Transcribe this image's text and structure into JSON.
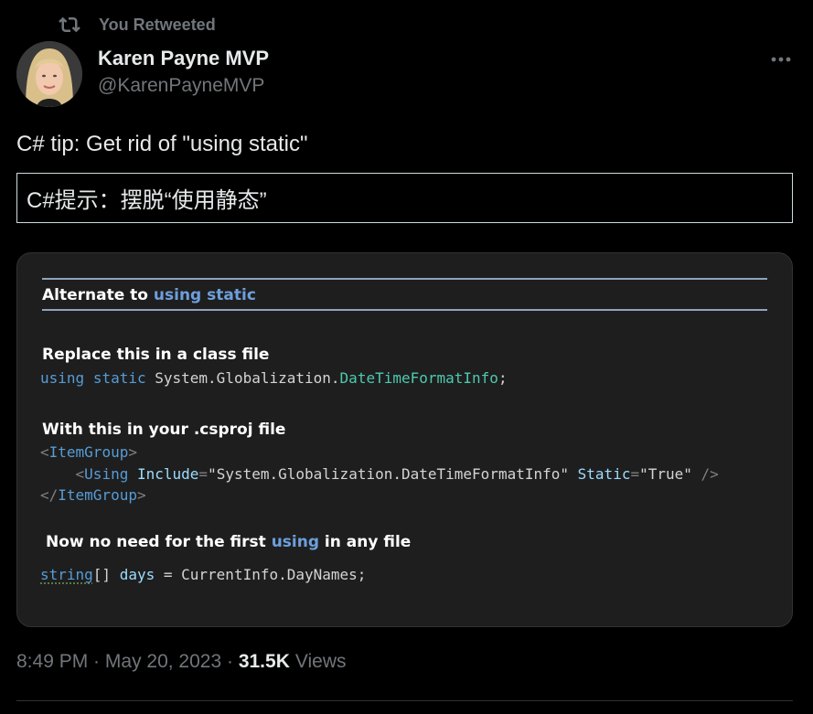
{
  "retweet": {
    "label": "You Retweeted"
  },
  "author": {
    "name": "Karen Payne MVP",
    "handle": "@KarenPayneMVP"
  },
  "tweet": {
    "text": "C# tip: Get rid of \"using static\"",
    "translation": "C#提示：摆脱“使用静态”"
  },
  "media": {
    "title_prefix": "Alternate to ",
    "title_keyword": "using static",
    "section1_heading": "Replace this in a class file",
    "section1_code": {
      "kw1": "using",
      "kw2": "static",
      "ns": "System.Globalization.",
      "type": "DateTimeFormatInfo",
      "end": ";"
    },
    "section2_heading": "With this in your .csproj file",
    "section2_code": {
      "open_tag": "ItemGroup",
      "using_tag": "Using",
      "include_attr": "Include",
      "include_val": "\"System.Globalization.DateTimeFormatInfo\"",
      "static_attr": "Static",
      "static_val": "\"True\"",
      "self_close": "/>",
      "close_tag": "ItemGroup"
    },
    "section3_prefix": "Now no need for the first ",
    "section3_keyword": "using",
    "section3_suffix": " in any file",
    "section3_code": {
      "type": "string",
      "brackets": "[]",
      "var": "days",
      "rest": "= CurrentInfo.DayNames;"
    }
  },
  "meta": {
    "time": "8:49 PM",
    "sep1": " · ",
    "date": "May 20, 2023",
    "sep2": " · ",
    "views_count": "31.5K",
    "views_label": "Views"
  },
  "icons": {
    "retweet": "retweet-icon",
    "more": "more-icon"
  },
  "colors": {
    "background": "#000000",
    "muted": "#71767b",
    "text": "#e7e9ea",
    "code_bg": "#1e1e1e",
    "keyword_blue": "#569cd6"
  }
}
